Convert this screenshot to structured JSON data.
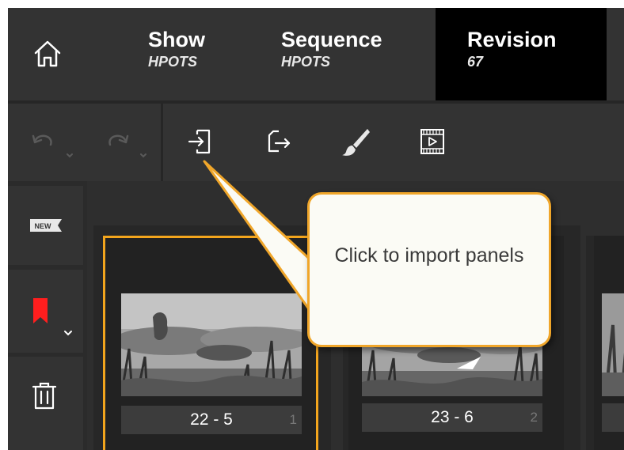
{
  "header": {
    "home_icon": "home-icon",
    "crumbs": [
      {
        "title": "Show",
        "sub": "HPOTS"
      },
      {
        "title": "Sequence",
        "sub": "HPOTS"
      },
      {
        "title": "Revision",
        "sub": "67"
      }
    ]
  },
  "toolbar": {
    "icons": [
      "undo-icon",
      "redo-icon",
      "import-panels-icon",
      "export-icon",
      "brush-icon",
      "film-icon"
    ]
  },
  "rail": {
    "new_badge": "NEW",
    "flag_color": "#ff1e1e"
  },
  "panels": [
    {
      "label": "22 - 5",
      "number": "1"
    },
    {
      "label": "23 - 6",
      "number": "2"
    }
  ],
  "tooltip": {
    "text": "Click to import panels"
  },
  "colors": {
    "accent": "#f3a51d",
    "header_bg": "#333333",
    "active_crumb_bg": "#000000"
  }
}
